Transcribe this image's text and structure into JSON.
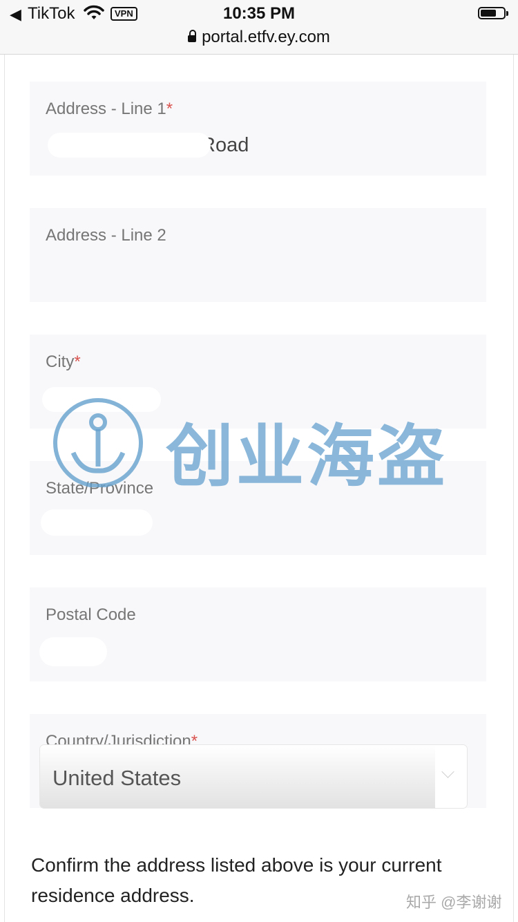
{
  "status_bar": {
    "back_app": "TikTok",
    "vpn": "VPN",
    "time": "10:35 PM",
    "url": "portal.etfv.ey.com"
  },
  "form": {
    "address1": {
      "label": "Address - Line 1",
      "required": "*",
      "value": "Road"
    },
    "address2": {
      "label": "Address - Line 2",
      "value": ""
    },
    "city": {
      "label": "City",
      "required": "*",
      "value": ""
    },
    "state": {
      "label": "State/Province",
      "value": ""
    },
    "postal": {
      "label": "Postal Code",
      "value": ""
    },
    "country": {
      "label": "Country/Jurisdiction",
      "required": "*",
      "selected": "United States"
    }
  },
  "confirm_text": "Confirm the address listed above is your current residence address.",
  "watermark": {
    "text": "创业海盗",
    "credit": "知乎 @李谢谢"
  },
  "colors": {
    "required": "#d9534f",
    "field_bg": "#f8f8fa",
    "watermark": "#64a0cd"
  }
}
